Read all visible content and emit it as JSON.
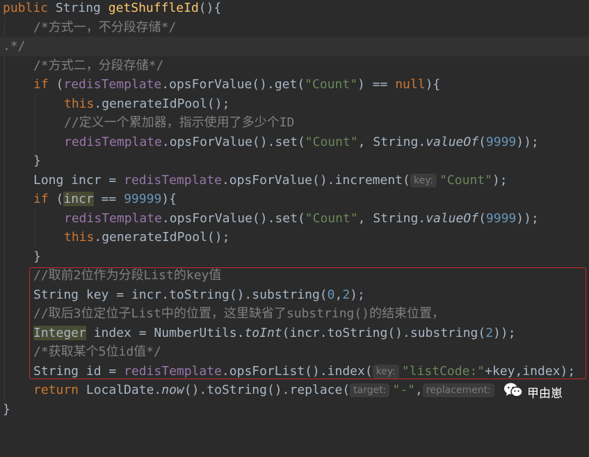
{
  "code": {
    "l1": {
      "kw": "public",
      "type": "String",
      "fn": "getShuffleId",
      "rest": "(){"
    },
    "l2": {
      "comment": "/*方式一，不分段存储*/"
    },
    "l3": {
      "text": ".*/"
    },
    "l4": {
      "comment": "/*方式二，分段存储*/"
    },
    "l5": {
      "kw": "if",
      "p1": " (",
      "field": "redisTemplate",
      "m1": ".opsForValue().get(",
      "str": "\"Count\"",
      "m2": ") == ",
      "null": "null",
      "end": "){"
    },
    "l6": {
      "kw": "this",
      "rest": ".generateIdPool();"
    },
    "l7": {
      "comment": "//定义一个累加器，指示使用了多少个ID"
    },
    "l8": {
      "field": "redisTemplate",
      "m1": ".opsForValue().set(",
      "str": "\"Count\"",
      "m2": ", String.",
      "method": "valueOf",
      "p": "(",
      "num": "9999",
      "end": "));"
    },
    "l9": {
      "text": "}"
    },
    "l10": {
      "a": "Long incr = ",
      "field": "redisTemplate",
      "m1": ".opsForValue().increment(",
      "hint": "key:",
      "str": "\"Count\"",
      "end": ");"
    },
    "l11": {
      "kw": "if",
      "p1": " (",
      "var": "incr",
      "m": " == ",
      "num": "99999",
      "end": "){"
    },
    "l12": {
      "field": "redisTemplate",
      "m1": ".opsForValue().set(",
      "str": "\"Count\"",
      "m2": ", String.",
      "method": "valueOf",
      "p": "(",
      "num": "9999",
      "end": "));"
    },
    "l13": {
      "kw": "this",
      "rest": ".generateIdPool();"
    },
    "l14": {
      "text": "}"
    },
    "l15": {
      "comment": "//取前2位作为分段List的key值"
    },
    "l16": {
      "a": "String key = incr.toString().substring(",
      "n1": "0",
      "c": ",",
      "n2": "2",
      "end": ");"
    },
    "l17": {
      "comment": "//取后3位定位子List中的位置，这里缺省了substring()的结束位置，"
    },
    "l18": {
      "type": "Integer",
      "a": " index = NumberUtils.",
      "method": "toInt",
      "b": "(incr.toString().substring(",
      "num": "2",
      "end": "));"
    },
    "l19": {
      "comment": "/*获取某个5位id值*/"
    },
    "l20": {
      "a": "String id = ",
      "field": "redisTemplate",
      "m1": ".opsForList().index(",
      "hint": "key:",
      "str": "\"listCode:\"",
      "end": "+key,index);"
    },
    "l21": {
      "kw": "return",
      "a": " LocalDate.",
      "method": "now",
      "b": "().toString().replace(",
      "hint1": "target:",
      "str": "\"-\"",
      "c": ",",
      "hint2": "replacement:"
    },
    "l22": {
      "text": "}"
    }
  },
  "watermark": {
    "text": "甲由崽",
    "icon": "wechat-icon"
  },
  "colors": {
    "keyword": "#cc7832",
    "function": "#ffc66d",
    "comment": "#808080",
    "string": "#6a8759",
    "number": "#6897bb",
    "field": "#9876aa",
    "highlight_box": "#c9282d"
  }
}
